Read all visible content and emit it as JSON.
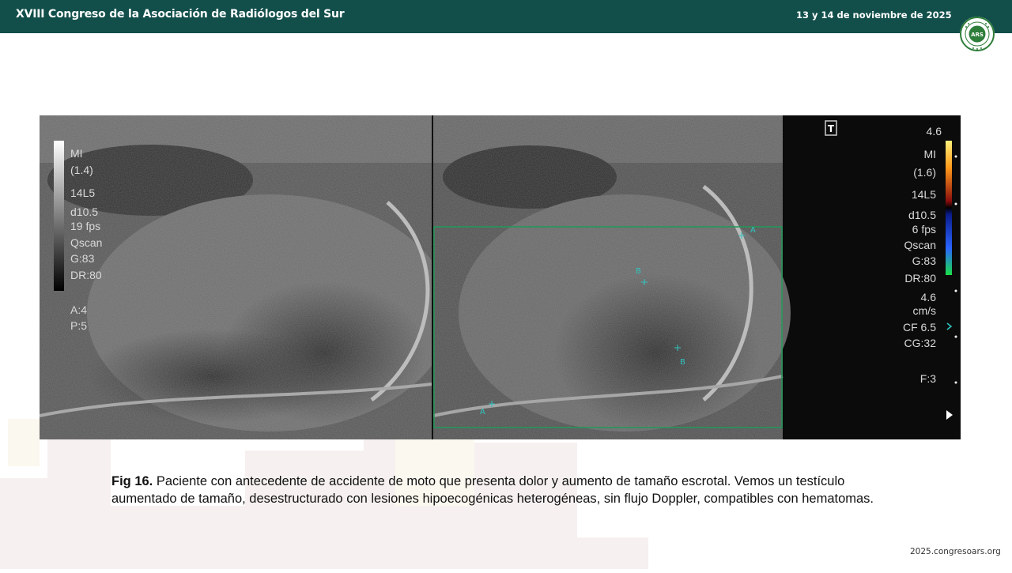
{
  "header": {
    "title": "XVIII Congreso de la Asociación de Radiólogos del Sur",
    "date": "13 y 14 de noviembre de 2025",
    "logo_text": "ARS",
    "logo_ring_text": "ASOCIACIÓN RADIÓLOGOS SUR"
  },
  "ultrasound": {
    "left_params": [
      "MI",
      "(1.4)",
      "14L5",
      "d10.5",
      "19 fps",
      "Qscan",
      "G:83",
      "DR:80",
      "A:4",
      "P:5"
    ],
    "right_params": [
      "4.6",
      "MI",
      "(1.6)",
      "14L5",
      "d10.5",
      "6 fps",
      "Qscan",
      "G:83",
      "DR:80",
      "4.6",
      "cm/s",
      "CF 6.5",
      "CG:32",
      "F:3"
    ],
    "markers": [
      "A",
      "B",
      "B",
      "A"
    ],
    "orientation_mark": "T"
  },
  "caption": {
    "label": "Fig 16.",
    "text": " Paciente con antecedente de accidente de moto que presenta dolor y aumento de tamaño escrotal. Vemos un testículo aumentado de tamaño, desestructurado con lesiones hipoecogénicas heterogéneas, sin flujo Doppler, compatibles con hematomas."
  },
  "footer": {
    "website": "2025.congresoars.org"
  },
  "colors": {
    "header_bg": "#124f4b",
    "logo_green": "#2e7d3a",
    "doppler_box": "#1f9a5a",
    "marker_cyan": "#2fc6c0"
  }
}
